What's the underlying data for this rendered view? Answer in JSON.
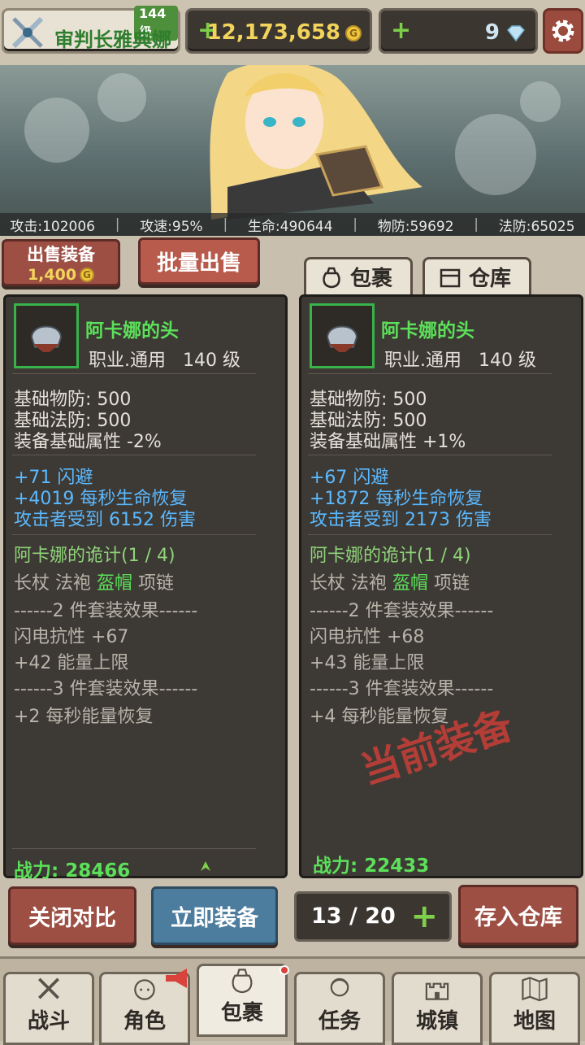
{
  "player": {
    "name": "审判长雅典娜",
    "level": "144 级"
  },
  "currency": {
    "gold": "12,173,658",
    "gems": "9",
    "plus": "+"
  },
  "stats": [
    "攻击:102006",
    "攻速:95%",
    "生命:490644",
    "物防:59692",
    "法防:65025"
  ],
  "stat_sep": "|",
  "buttons": {
    "sell": "出售装备",
    "sell_price": "1,400",
    "bulk_sell": "批量出售",
    "close_compare": "关闭对比",
    "equip_now": "立即装备",
    "store": "存入仓库",
    "coin_glyph": "G"
  },
  "tabs": {
    "bag": "包裹",
    "storage": "仓库"
  },
  "capacity": "13 / 20",
  "left_item": {
    "name": "阿卡娜的头",
    "class": "职业.通用   140 级",
    "base": [
      "基础物防: 500",
      "基础法防: 500",
      "装备基础属性 -2%"
    ],
    "bonus": [
      "+71 闪避",
      "+4019 每秒生命恢复",
      "攻击者受到 6152 伤害"
    ],
    "set_name": "阿卡娜的诡计(1 / 4)",
    "set_pieces": [
      "长杖",
      "法袍",
      "盔帽",
      "项链"
    ],
    "set2_title": "------2 件套装效果------",
    "set2": [
      "闪电抗性 +67",
      "+42 能量上限"
    ],
    "set3_title": "------3 件套装效果------",
    "set3": [
      "+2 每秒能量恢复"
    ],
    "power_label": "战力:",
    "power": "28466"
  },
  "right_item": {
    "name": "阿卡娜的头",
    "class": "职业.通用   140 级",
    "base": [
      "基础物防: 500",
      "基础法防: 500",
      "装备基础属性 +1%"
    ],
    "bonus": [
      "+67 闪避",
      "+1872 每秒生命恢复",
      "攻击者受到 2173 伤害"
    ],
    "set_name": "阿卡娜的诡计(1 / 4)",
    "set_pieces": [
      "长杖",
      "法袍",
      "盔帽",
      "项链"
    ],
    "set2_title": "------2 件套装效果------",
    "set2": [
      "闪电抗性 +68",
      "+43 能量上限"
    ],
    "set3_title": "------3 件套装效果------",
    "set3": [
      "+4 每秒能量恢复"
    ],
    "power_label": "战力:",
    "power": "22433"
  },
  "current_equipped_stamp": "当前装备",
  "nav": [
    "战斗",
    "角色",
    "包裹",
    "任务",
    "城镇",
    "地图"
  ],
  "colors": {
    "accent_green": "#5ce05a",
    "bonus_blue": "#5bb9ff",
    "stamp_red": "#c84038",
    "gold": "#f2d45c"
  }
}
